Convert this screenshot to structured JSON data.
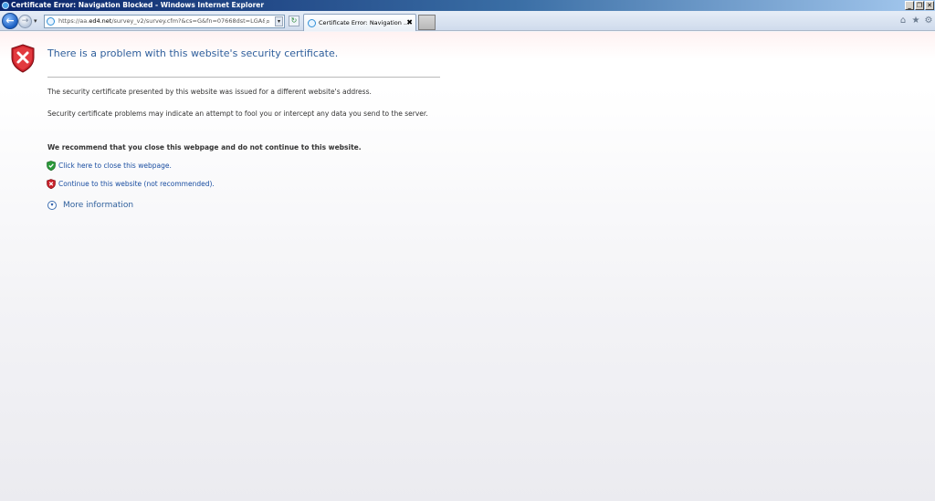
{
  "window": {
    "title": "Certificate Error: Navigation Blocked - Windows Internet Explorer",
    "minimize": "_",
    "restore": "❐",
    "close": "✕"
  },
  "navbar": {
    "back_glyph": "←",
    "forward_glyph": "→",
    "address_url_prefix": "https://aa.",
    "address_url_domain": "ed4.net",
    "address_url_rest": "/survey_v2/survey.cfm?&cs=G&fn=07668dst=LGA&r",
    "search_glyph": "⌕",
    "dropdown_glyph": "▾",
    "refresh_glyph": "↻",
    "tab_label": "Certificate Error: Navigation ...",
    "tab_close": "✖",
    "home_glyph": "⌂",
    "favorites_glyph": "★",
    "tools_glyph": "⚙"
  },
  "error_page": {
    "headline": "There is a problem with this website's security certificate.",
    "para1": "The security certificate presented by this website was issued for a different website's address.",
    "para2": "Security certificate problems may indicate an attempt to fool you or intercept any data you send to the server.",
    "recommendation": "We recommend that you close this webpage and do not continue to this website.",
    "close_link": "Click here to close this webpage.",
    "continue_link": "Continue to this website (not recommended).",
    "more_info": "More information",
    "more_info_glyph": "▾"
  },
  "colors": {
    "link": "#1a4ea1",
    "headline": "#2e5f9c",
    "shield_red": "#c8202a",
    "shield_green": "#2a9a3a"
  }
}
